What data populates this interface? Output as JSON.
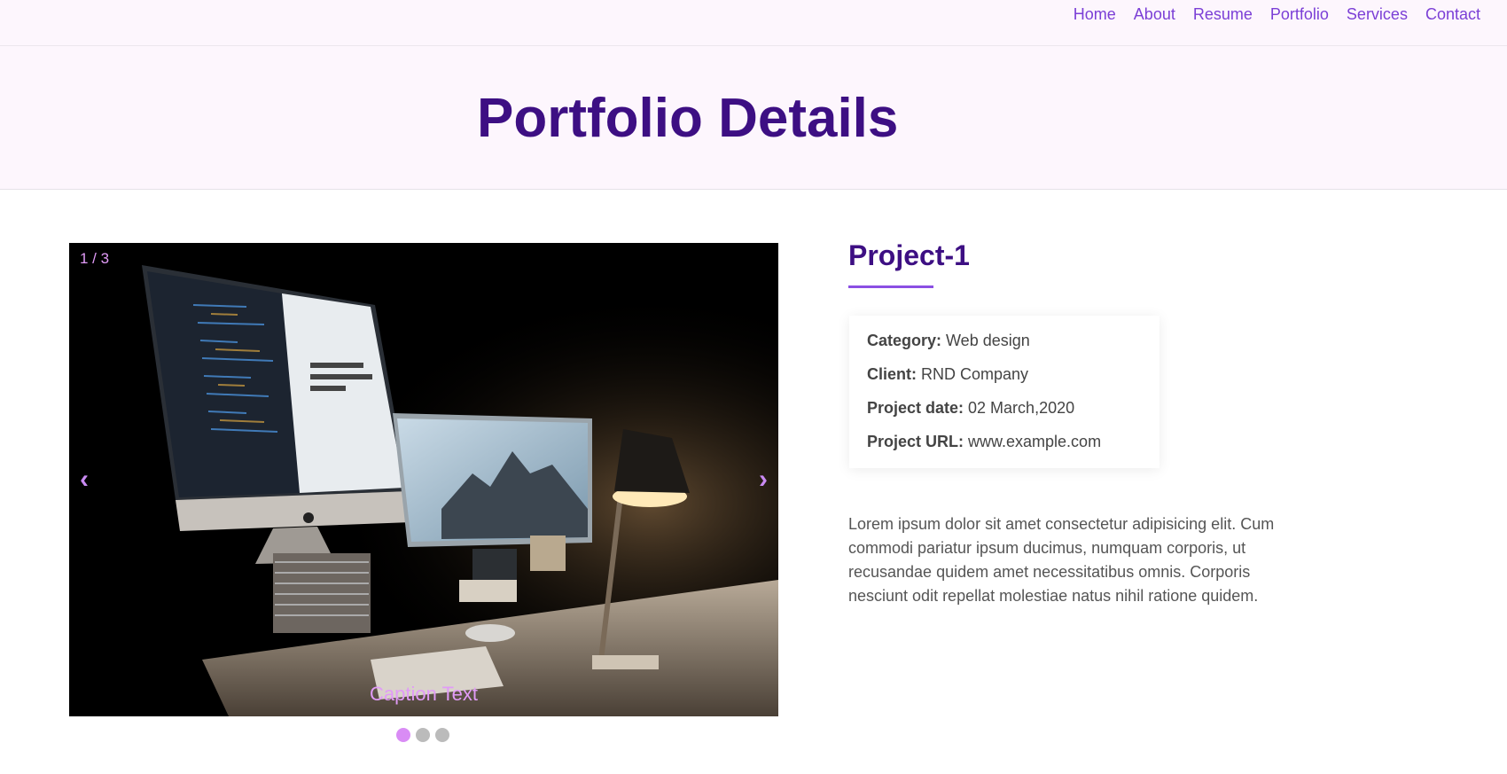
{
  "nav": {
    "items": [
      "Home",
      "About",
      "Resume",
      "Portfolio",
      "Services",
      "Contact"
    ]
  },
  "hero": {
    "title": "Portfolio Details"
  },
  "slider": {
    "counter": "1 / 3",
    "prev_icon": "‹",
    "next_icon": "›",
    "caption": "Caption Text",
    "slide_count": 3,
    "active_index": 0
  },
  "project": {
    "title": "Project-1",
    "info": [
      {
        "label": "Category:",
        "value": "Web design"
      },
      {
        "label": "Client:",
        "value": "RND Company"
      },
      {
        "label": "Project date:",
        "value": "02 March,2020"
      },
      {
        "label": "Project URL:",
        "value": "www.example.com"
      }
    ],
    "description": "Lorem ipsum dolor sit amet consectetur adipisicing elit. Cum commodi pariatur ipsum ducimus, numquam corporis, ut recusandae quidem amet necessitatibus omnis. Corporis nesciunt odit repellat molestiae natus nihil ratione quidem."
  },
  "colors": {
    "accent": "#7b3fd6",
    "heading": "#3d0f83",
    "header_bg": "#fdf6fd",
    "slider_accent": "#e19bf7"
  }
}
